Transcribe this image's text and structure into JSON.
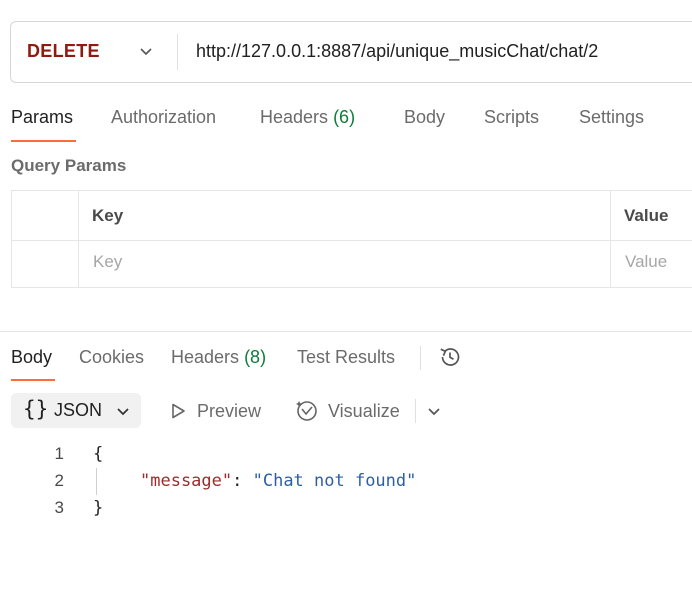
{
  "request": {
    "method": "DELETE",
    "url": "http://127.0.0.1:8887/api/unique_musicChat/chat/2"
  },
  "request_tabs": {
    "params": "Params",
    "authorization": "Authorization",
    "headers": "Headers",
    "headers_count": "(6)",
    "body": "Body",
    "scripts": "Scripts",
    "settings": "Settings"
  },
  "query_params": {
    "title": "Query Params",
    "col_key": "Key",
    "col_value": "Value",
    "key_placeholder": "Key",
    "value_placeholder": "Value"
  },
  "response_tabs": {
    "body": "Body",
    "cookies": "Cookies",
    "headers": "Headers",
    "headers_count": "(8)",
    "test_results": "Test Results"
  },
  "toolbar": {
    "format": "JSON",
    "preview": "Preview",
    "visualize": "Visualize"
  },
  "response_body": {
    "line_numbers": [
      "1",
      "2",
      "3"
    ],
    "open_brace": "{",
    "key": "\"message\"",
    "colon": ": ",
    "value": "\"Chat not found\"",
    "close_brace": "}"
  },
  "colors": {
    "accent": "#ff6c37",
    "method": "#8e1a10",
    "count": "#0e7c3a",
    "json_key": "#9c2b2b",
    "json_string": "#2f5fa3"
  },
  "icons": [
    "chevron-down-icon",
    "history-icon",
    "braces-icon",
    "play-icon",
    "visualize-icon"
  ]
}
